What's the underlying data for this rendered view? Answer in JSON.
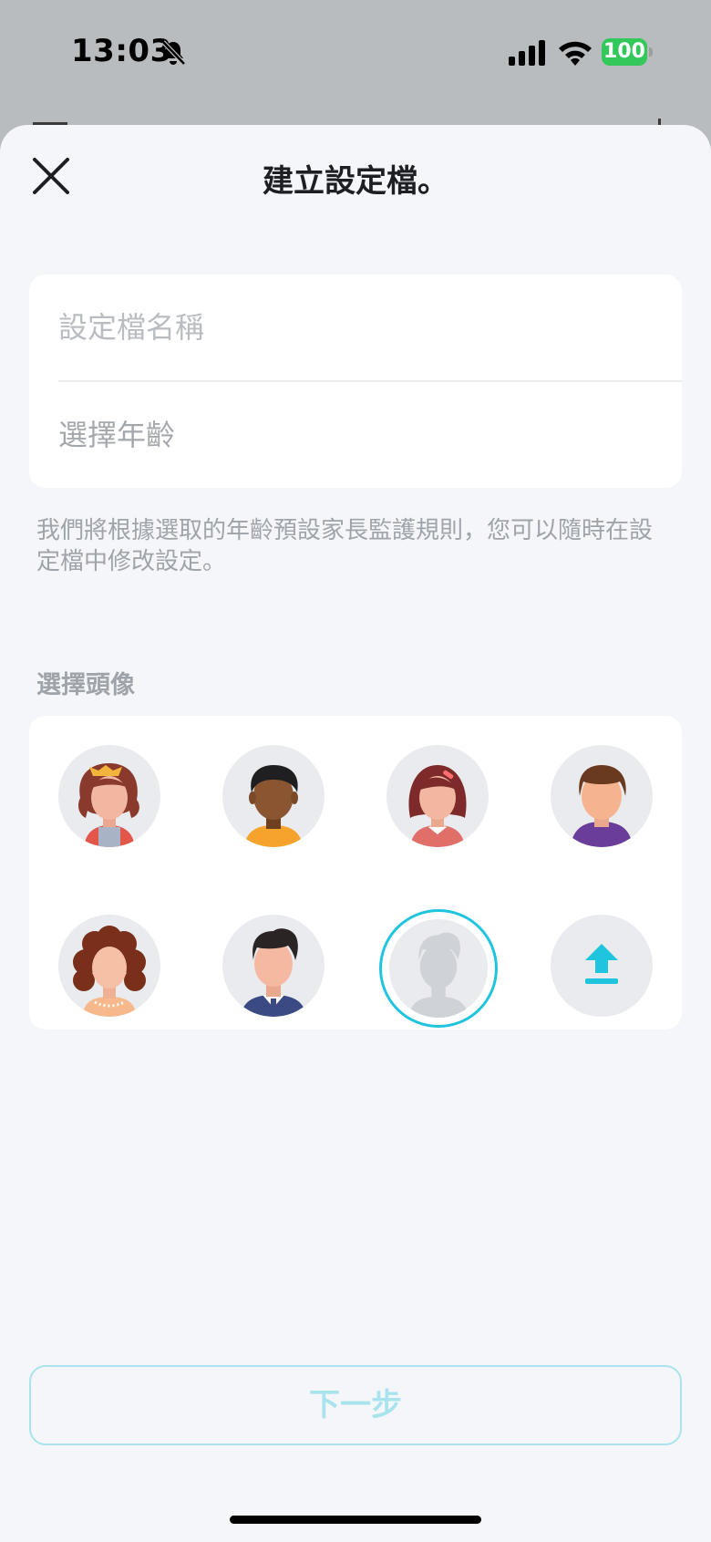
{
  "status_bar": {
    "time": "13:03",
    "battery": "100"
  },
  "header": {
    "title": "建立設定檔。"
  },
  "form": {
    "name_placeholder": "設定檔名稱",
    "age_placeholder": "選擇年齡"
  },
  "hint": "我們將根據選取的年齡預設家長監護規則，您可以隨時在設定檔中修改設定。",
  "avatars": {
    "label": "選擇頭像",
    "items": [
      "girl-bow",
      "boy-dark-skin",
      "girl-hairclip",
      "boy-hoodie",
      "woman-curly",
      "man-suit",
      "default-silhouette",
      "upload"
    ],
    "selected": "default-silhouette"
  },
  "footer": {
    "next_label": "下一步"
  },
  "colors": {
    "accent": "#1fc4de",
    "accent_disabled": "#a9e4ee",
    "background": "#f4f6f9",
    "battery": "#34c759"
  }
}
